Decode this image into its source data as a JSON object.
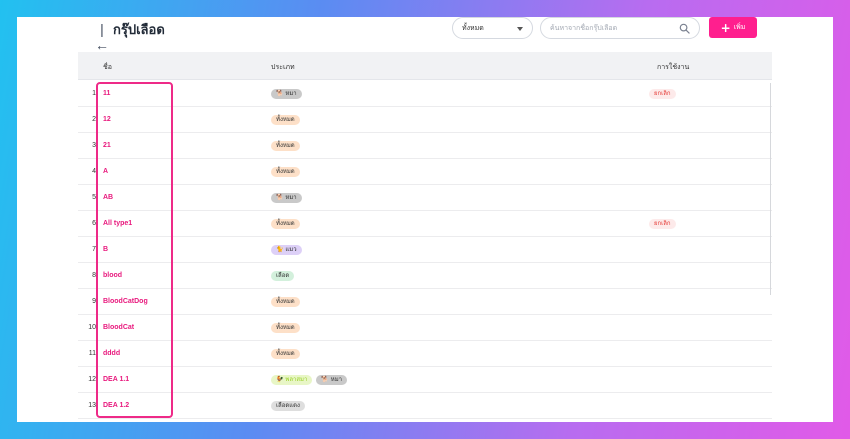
{
  "header": {
    "back_icon": "collapse-left-icon",
    "title": "กรุ๊ปเลือด",
    "filter": {
      "selected": "ทั้งหมด"
    },
    "search": {
      "placeholder": "ค้นหาจากชื่อกรุ๊ปเลือด",
      "value": ""
    },
    "add_label": "เพิ่ม"
  },
  "table": {
    "columns": [
      "ชื่อ",
      "ประเภท",
      "การใช้งาน"
    ],
    "rows": [
      {
        "index": "1",
        "name": "11",
        "types": [
          {
            "label": "🐕 หมา",
            "kind": "dog"
          }
        ],
        "usage": "ยกเลิก"
      },
      {
        "index": "2",
        "name": "12",
        "types": [
          {
            "label": "ทั้งหมด",
            "kind": "all"
          }
        ],
        "usage": ""
      },
      {
        "index": "3",
        "name": "21",
        "types": [
          {
            "label": "ทั้งหมด",
            "kind": "all"
          }
        ],
        "usage": ""
      },
      {
        "index": "4",
        "name": "A",
        "types": [
          {
            "label": "ทั้งหมด",
            "kind": "all"
          }
        ],
        "usage": ""
      },
      {
        "index": "5",
        "name": "AB",
        "types": [
          {
            "label": "🐕 หมา",
            "kind": "dog"
          }
        ],
        "usage": ""
      },
      {
        "index": "6",
        "name": "All type1",
        "types": [
          {
            "label": "ทั้งหมด",
            "kind": "all"
          }
        ],
        "usage": "ยกเลิก"
      },
      {
        "index": "7",
        "name": "B",
        "types": [
          {
            "label": "🐈 แมว",
            "kind": "cat"
          }
        ],
        "usage": ""
      },
      {
        "index": "8",
        "name": "blood",
        "types": [
          {
            "label": "เลือด",
            "kind": "blood"
          }
        ],
        "usage": ""
      },
      {
        "index": "9",
        "name": "BloodCatDog",
        "types": [
          {
            "label": "ทั้งหมด",
            "kind": "all"
          }
        ],
        "usage": ""
      },
      {
        "index": "10",
        "name": "BloodCat",
        "types": [
          {
            "label": "ทั้งหมด",
            "kind": "all"
          }
        ],
        "usage": ""
      },
      {
        "index": "11",
        "name": "dddd",
        "types": [
          {
            "label": "ทั้งหมด",
            "kind": "all"
          }
        ],
        "usage": ""
      },
      {
        "index": "12",
        "name": "DEA 1.1",
        "types": [
          {
            "label": "🐓 พลาสมา",
            "kind": "plasma"
          },
          {
            "label": "🐕 หมา",
            "kind": "dog"
          }
        ],
        "usage": ""
      },
      {
        "index": "13",
        "name": "DEA 1.2",
        "types": [
          {
            "label": "เลือดแดง",
            "kind": "other"
          }
        ],
        "usage": ""
      }
    ]
  },
  "colors": {
    "accent": "#ff1f8e",
    "name_link": "#e8197d",
    "usage_cancel": "#e53935",
    "highlight": "#ee2a88"
  }
}
